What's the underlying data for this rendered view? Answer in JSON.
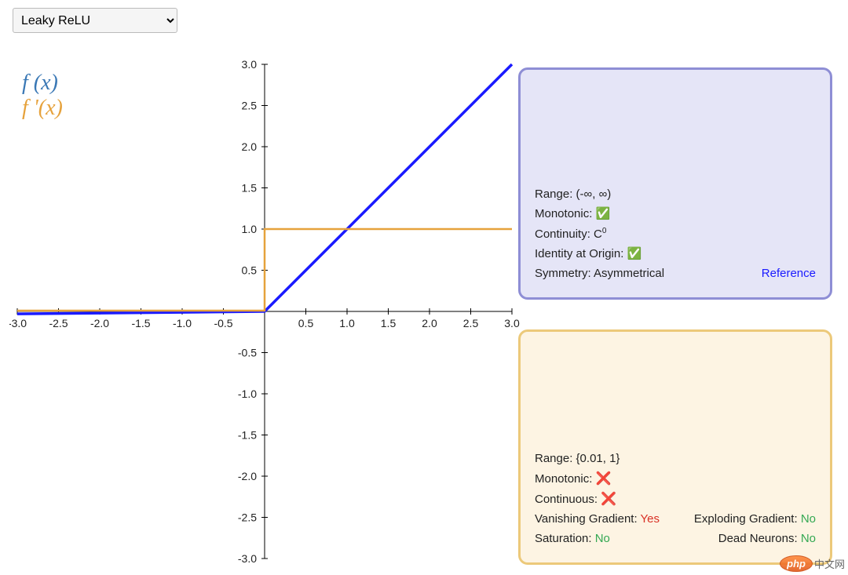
{
  "selector": {
    "selected": "Leaky ReLU",
    "options": [
      "Leaky ReLU"
    ]
  },
  "legend": {
    "fx": "f (x)",
    "fprime": "f '(x)"
  },
  "panel_fx": {
    "range_label": "Range:",
    "range_value": "(-∞, ∞)",
    "monotonic_label": "Monotonic:",
    "monotonic_value": "✅",
    "continuity_label": "Continuity:",
    "continuity_value": "C",
    "continuity_sup": "0",
    "identity_label": "Identity at Origin:",
    "identity_value": "✅",
    "symmetry_label": "Symmetry:",
    "symmetry_value": "Asymmetrical",
    "reference": "Reference"
  },
  "panel_fprime": {
    "range_label": "Range:",
    "range_value": "{0.01, 1}",
    "monotonic_label": "Monotonic:",
    "monotonic_value": "❌",
    "continuous_label": "Continuous:",
    "continuous_value": "❌",
    "vanishing_label": "Vanishing Gradient:",
    "vanishing_value": "Yes",
    "exploding_label": "Exploding Gradient:",
    "exploding_value": "No",
    "saturation_label": "Saturation:",
    "saturation_value": "No",
    "dead_label": "Dead Neurons:",
    "dead_value": "No"
  },
  "watermark": {
    "logo": "php",
    "text": "中文网"
  },
  "chart_data": {
    "type": "line",
    "title": "",
    "xlabel": "",
    "ylabel": "",
    "xlim": [
      -3.0,
      3.0
    ],
    "ylim": [
      -3.0,
      3.0
    ],
    "xticks": [
      -3.0,
      -2.5,
      -2.0,
      -1.5,
      -1.0,
      -0.5,
      0.5,
      1.0,
      1.5,
      2.0,
      2.5,
      3.0
    ],
    "yticks": [
      -3.0,
      -2.5,
      -2.0,
      -1.5,
      -1.0,
      -0.5,
      0.5,
      1.0,
      1.5,
      2.0,
      2.5,
      3.0
    ],
    "series": [
      {
        "name": "f(x)",
        "color": "#1a1aff",
        "points": [
          [
            -3.0,
            -0.03
          ],
          [
            0.0,
            0.0
          ],
          [
            3.0,
            3.0
          ]
        ]
      },
      {
        "name": "f'(x)",
        "color": "#e6a23c",
        "points": [
          [
            -3.0,
            0.01
          ],
          [
            0.0,
            0.01
          ],
          [
            0.0,
            1.0
          ],
          [
            3.0,
            1.0
          ]
        ]
      }
    ]
  }
}
